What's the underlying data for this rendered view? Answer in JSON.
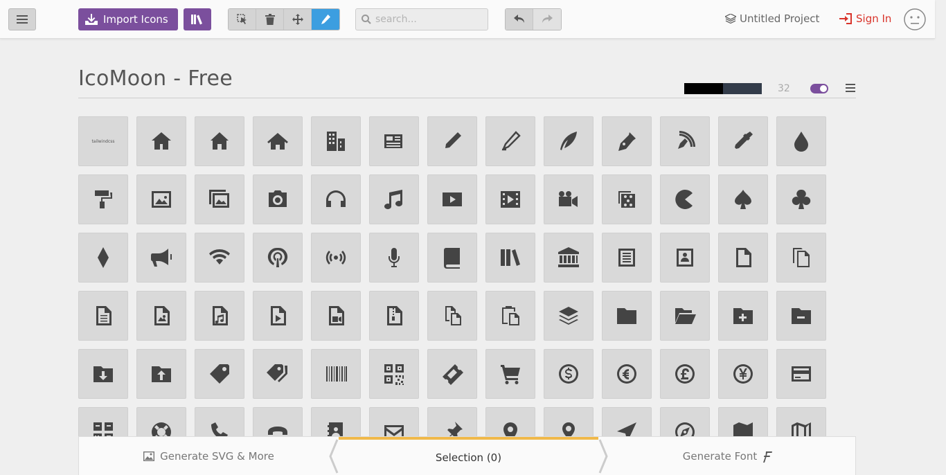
{
  "toolbar": {
    "import_label": "Import Icons",
    "search_placeholder": "search...",
    "project_label": "Untitled Project",
    "signin_label": "Sign In",
    "accent": "#7b4f9d",
    "active_tool_color": "#3c9ee0",
    "signin_color": "#d9342b"
  },
  "set": {
    "title": "IcoMoon - Free",
    "size": "32",
    "swatch_colors": [
      "#000000",
      "#333c4a"
    ]
  },
  "icons": [
    "tailwindcss-logo",
    "home",
    "home2",
    "home3",
    "office",
    "newspaper",
    "pencil",
    "pencil2",
    "quill",
    "pen",
    "blog",
    "eyedropper",
    "droplet",
    "paint-format",
    "image",
    "images",
    "camera",
    "headphones",
    "music",
    "play",
    "film",
    "video-camera",
    "dice",
    "pacman",
    "spades",
    "clubs",
    "diamonds",
    "bullhorn",
    "connection",
    "podcast",
    "feed",
    "mic",
    "book",
    "books",
    "library",
    "file-text",
    "profile",
    "file-empty",
    "files-empty",
    "file-text2",
    "file-picture",
    "file-music",
    "file-play",
    "file-video",
    "file-zip",
    "copy",
    "paste",
    "stack",
    "folder",
    "folder-open",
    "folder-plus",
    "folder-minus",
    "folder-download",
    "folder-upload",
    "price-tag",
    "price-tags",
    "barcode",
    "qrcode",
    "ticket",
    "cart",
    "coin-dollar",
    "coin-euro",
    "coin-pound",
    "coin-yen",
    "credit-card",
    "calculator",
    "lifebuoy",
    "phone",
    "phone-hang-up",
    "address-book",
    "envelop",
    "pushpin",
    "location",
    "location2",
    "compass",
    "compass2",
    "map",
    "map2"
  ],
  "logo_text": "tailwindcss",
  "bottom": {
    "generate_svg": "Generate SVG & More",
    "selection": "Selection (0)",
    "generate_font": "Generate Font",
    "progress_color": "#f0b94a"
  }
}
